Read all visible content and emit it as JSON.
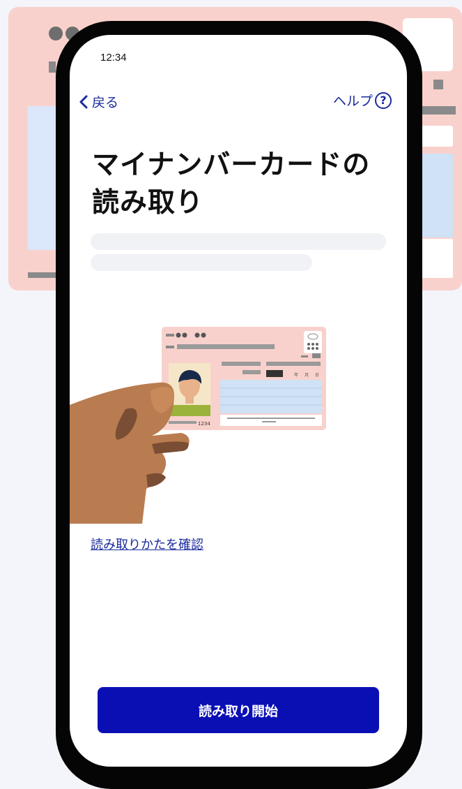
{
  "status_bar": {
    "time": "12:34"
  },
  "nav": {
    "back_label": "戻る",
    "help_label": "ヘルプ",
    "help_icon_glyph": "?"
  },
  "title_line1": "マイナンバーカードの",
  "title_line2": "読み取り",
  "card_illustration": {
    "number": "1234",
    "year_label": "年",
    "month_label": "月",
    "day_label": "日"
  },
  "confirm_link": "読み取りかたを確認",
  "start_button": "読み取り開始",
  "colors": {
    "primary": "#0a0fb4",
    "link": "#1a2a9c",
    "card_pink": "#f9d1cc",
    "background": "#f4f5fa"
  },
  "icons": [
    "chevron-left-icon",
    "help-circle-icon"
  ]
}
